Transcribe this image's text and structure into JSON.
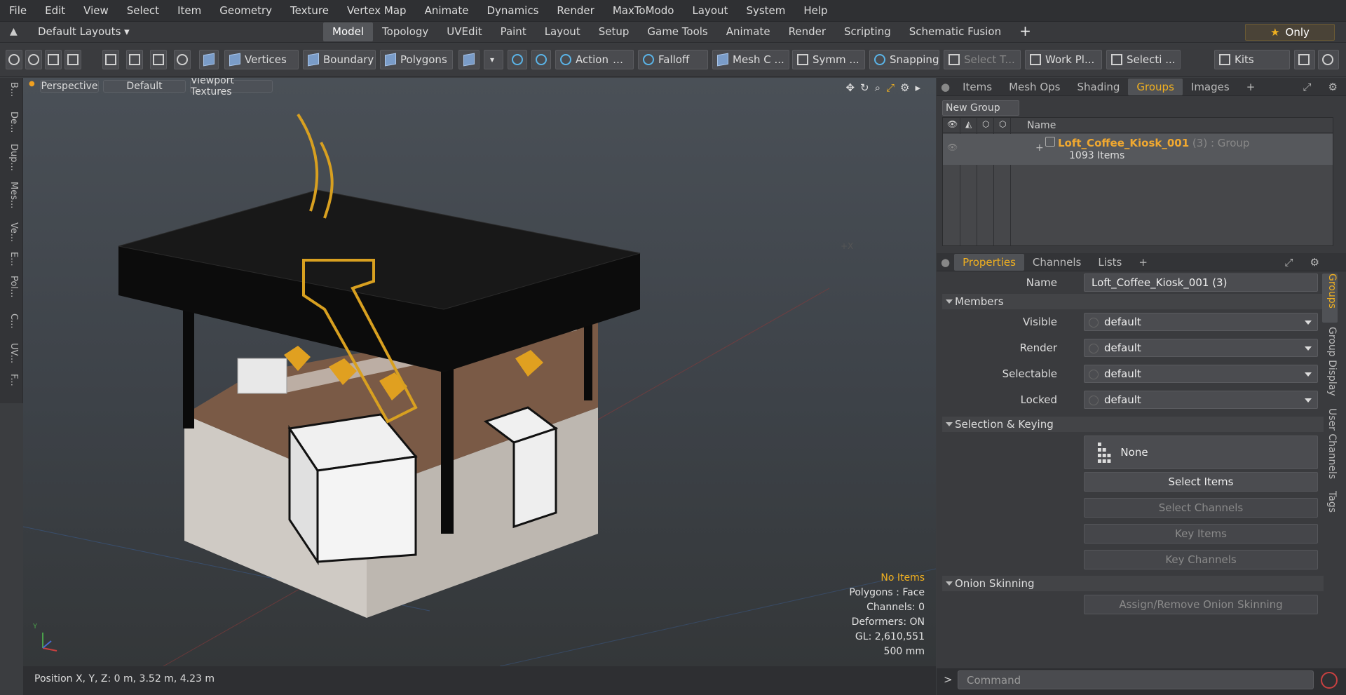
{
  "menu": [
    "File",
    "Edit",
    "View",
    "Select",
    "Item",
    "Geometry",
    "Texture",
    "Vertex Map",
    "Animate",
    "Dynamics",
    "Render",
    "MaxToModo",
    "Layout",
    "System",
    "Help"
  ],
  "layout": {
    "selector": "Default Layouts ▾",
    "only_label": "Only"
  },
  "tabs": [
    "Model",
    "Topology",
    "UVEdit",
    "Paint",
    "Layout",
    "Setup",
    "Game Tools",
    "Animate",
    "Render",
    "Scripting",
    "Schematic Fusion"
  ],
  "active_tab": "Model",
  "toolbar": {
    "vertices": "Vertices",
    "boundary": "Boundary",
    "polygons": "Polygons",
    "action": "Action",
    "falloff": "Falloff",
    "mesh": "Mesh C ...",
    "symm": "Symm ...",
    "snapping": "Snapping",
    "select_t": "Select T...",
    "workpl": "Work Pl...",
    "selecti": "Selecti ...",
    "kits": "Kits"
  },
  "left_strip": [
    "B...",
    "De...",
    "Dup...",
    "Mes...",
    "Ve...",
    "E...",
    "Pol...",
    "C...",
    "UV...",
    "F..."
  ],
  "viewport": {
    "perspective": "Perspective",
    "default": "Default",
    "textures": "Viewport Textures",
    "x_marker": "+X",
    "y_marker": "Y"
  },
  "stats": {
    "no_items": "No Items",
    "polygons": "Polygons : Face",
    "channels": "Channels: 0",
    "deformers": "Deformers: ON",
    "gl": "GL: 2,610,551",
    "scale": "500 mm"
  },
  "status": {
    "position": "Position X, Y, Z:   0 m, 3.52 m, 4.23 m"
  },
  "top_tabs": [
    "Items",
    "Mesh Ops",
    "Shading",
    "Groups",
    "Images"
  ],
  "top_active": "Groups",
  "groups": {
    "new_group": "New Group",
    "col_name": "Name",
    "row_name": "Loft_Coffee_Kiosk_001",
    "row_suffix": " (3) : Group",
    "row_sub": "1093 Items"
  },
  "prop_tabs": [
    "Properties",
    "Channels",
    "Lists"
  ],
  "prop_active": "Properties",
  "properties": {
    "name_label": "Name",
    "name_value": "Loft_Coffee_Kiosk_001 (3)",
    "members": "Members",
    "visible_label": "Visible",
    "visible_value": "default",
    "render_label": "Render",
    "render_value": "default",
    "selectable_label": "Selectable",
    "selectable_value": "default",
    "locked_label": "Locked",
    "locked_value": "default",
    "sel_keying": "Selection & Keying",
    "none": "None",
    "select_items": "Select Items",
    "select_channels": "Select Channels",
    "key_items": "Key Items",
    "key_channels": "Key Channels",
    "onion": "Onion Skinning",
    "assign_onion": "Assign/Remove Onion Skinning"
  },
  "side_vtabs": [
    "Groups",
    "Group Display",
    "User Channels",
    "Tags"
  ],
  "command": {
    "placeholder": "Command"
  },
  "colors": {
    "accent": "#f0b020",
    "bg": "#3a3b3e"
  }
}
